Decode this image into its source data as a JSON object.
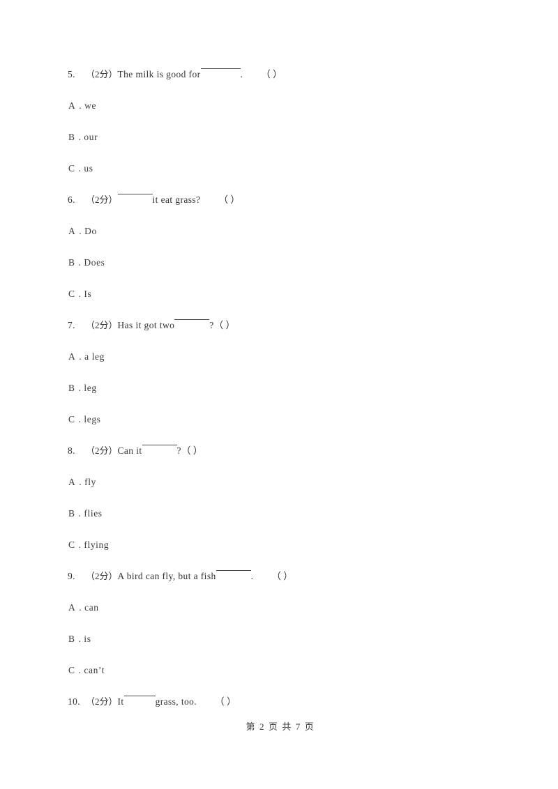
{
  "document": {
    "page_footer": {
      "prefix": "第",
      "current_page": "2",
      "middle": "页  共",
      "total_pages": "7",
      "suffix": "页",
      "full_text": "第 2 页 共 7 页"
    }
  },
  "questions": [
    {
      "number": "5.",
      "score": "（2分）",
      "text_before": "The milk is good for",
      "blank": "_______",
      "text_after": ".",
      "answer_paren": "（      ）",
      "options": [
        {
          "letter": "A",
          "dot": ".",
          "text": "we"
        },
        {
          "letter": "B",
          "dot": ".",
          "text": "our"
        },
        {
          "letter": "C",
          "dot": ".",
          "text": "us"
        }
      ]
    },
    {
      "number": "6.",
      "score": "（2分）",
      "text_before": "",
      "blank": "______",
      "text_after": "it eat grass?",
      "answer_paren": "（      ）",
      "options": [
        {
          "letter": "A",
          "dot": ".",
          "text": "Do"
        },
        {
          "letter": "B",
          "dot": ".",
          "text": "Does"
        },
        {
          "letter": "C",
          "dot": ".",
          "text": "Is"
        }
      ]
    },
    {
      "number": "7.",
      "score": "（2分）",
      "text_before": "Has it got two",
      "blank": "______",
      "text_after": "?",
      "answer_paren": "（      ）",
      "options": [
        {
          "letter": "A",
          "dot": ".",
          "text": "a leg"
        },
        {
          "letter": "B",
          "dot": ".",
          "text": "leg"
        },
        {
          "letter": "C",
          "dot": ".",
          "text": "legs"
        }
      ]
    },
    {
      "number": "8.",
      "score": "（2分）",
      "text_before": "Can it",
      "blank": "______",
      "text_after": "?",
      "answer_paren": "（      ）",
      "options": [
        {
          "letter": "A",
          "dot": ".",
          "text": "fly"
        },
        {
          "letter": "B",
          "dot": ".",
          "text": "flies"
        },
        {
          "letter": "C",
          "dot": ".",
          "text": "flying"
        }
      ]
    },
    {
      "number": "9.",
      "score": "（2分）",
      "text_before": "A bird can fly, but a fish",
      "blank": "______",
      "text_after": ".",
      "answer_paren": "（      ）",
      "options": [
        {
          "letter": "A",
          "dot": ".",
          "text": "can"
        },
        {
          "letter": "B",
          "dot": ".",
          "text": "is"
        },
        {
          "letter": "C",
          "dot": ".",
          "text": "can’t"
        }
      ]
    },
    {
      "number": "10.",
      "score": "（2分）",
      "text_before": "It",
      "blank": "______",
      "text_after": "grass, too.",
      "answer_paren": "（      ）",
      "options": []
    }
  ]
}
